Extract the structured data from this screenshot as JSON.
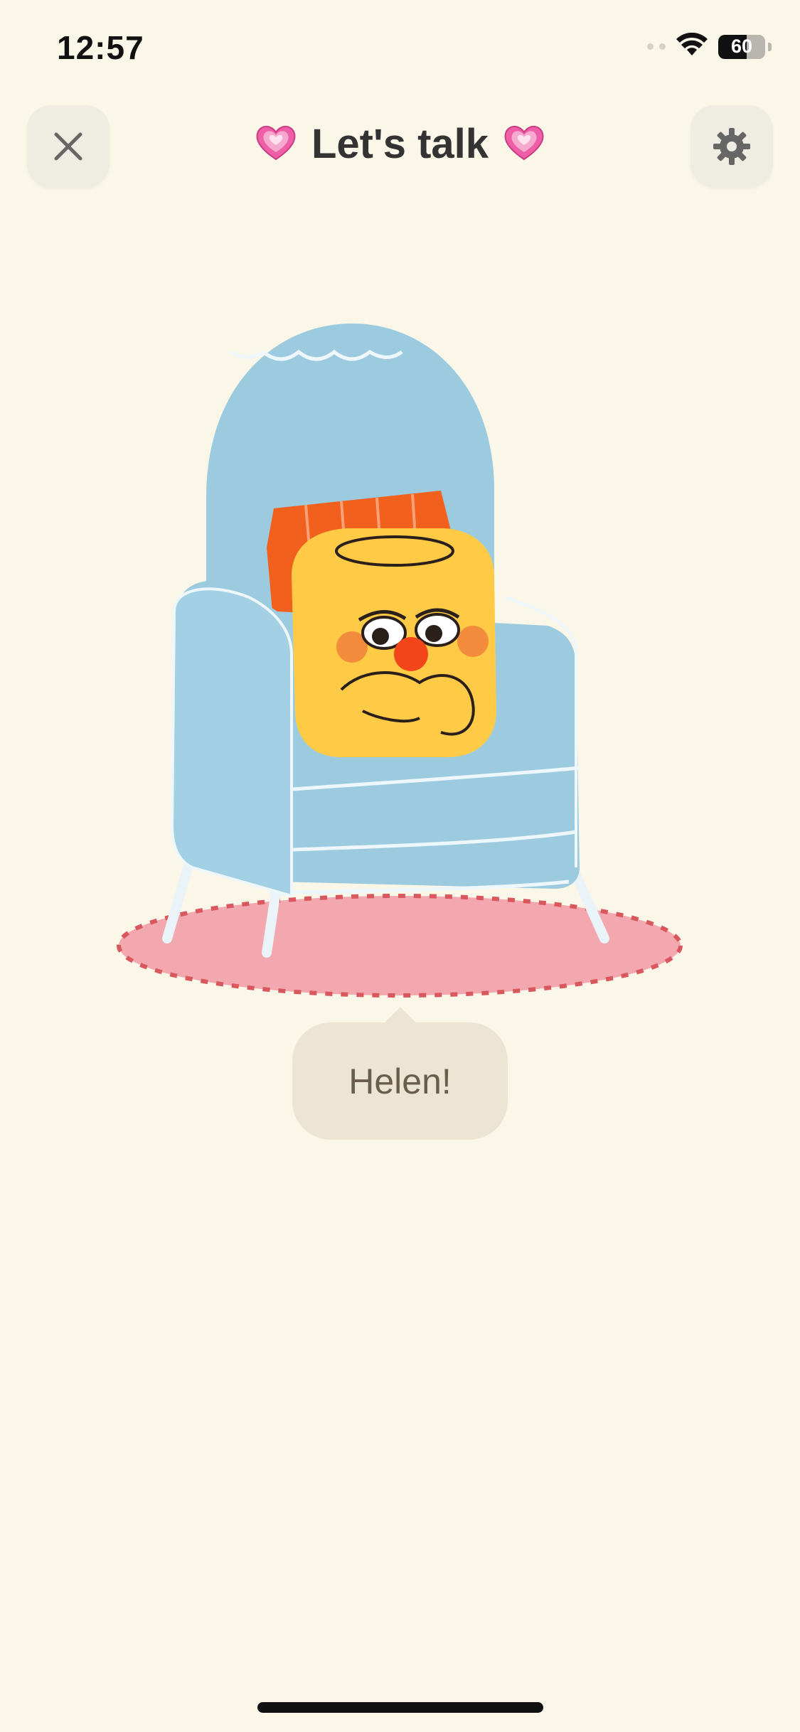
{
  "status_bar": {
    "time": "12:57",
    "battery_percent": "60",
    "battery_level": 0.6,
    "icons": [
      "signal-dots-icon",
      "wifi-icon",
      "battery-icon"
    ]
  },
  "header": {
    "title": "Let's talk",
    "title_decoration": "💗",
    "close_icon": "close-icon",
    "settings_icon": "gear-icon"
  },
  "illustration": {
    "subject": "character-on-armchair"
  },
  "speech_bubble": {
    "text": "Helen!"
  },
  "colors": {
    "background": "#faf6e8",
    "button_bg": "#efece2",
    "bubble_bg": "#ede5d4",
    "bubble_text": "#6b5d4c",
    "armchair": "#9ccbe0",
    "rug": "#f2a8ae",
    "pillow": "#f2601e",
    "character": "#ffcb47"
  }
}
